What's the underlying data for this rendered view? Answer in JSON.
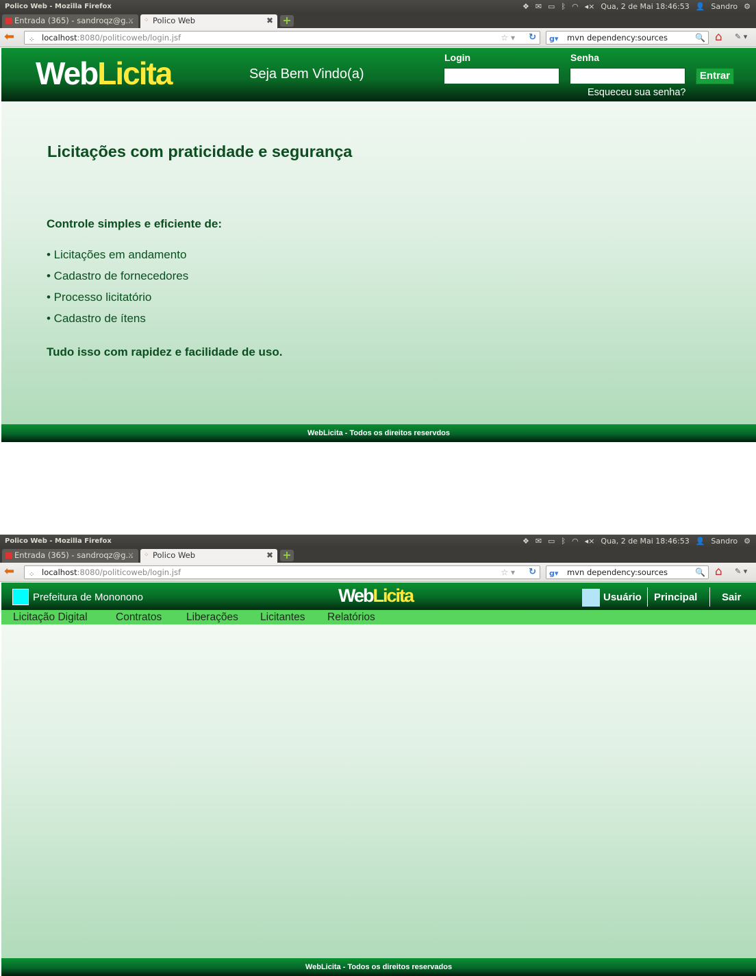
{
  "screenshots": [
    {
      "window_title": "Polico Web - Mozilla Firefox",
      "tray": {
        "date_time": "Qua, 2 de Mai 18:46:53",
        "user": "Sandro"
      },
      "tabs": [
        {
          "label": "Entrada (365) - sandroqz@g..."
        },
        {
          "label": "Polico Web"
        }
      ],
      "url": {
        "host": "localhost",
        "rest": ":8080/politicoweb/login.jsf"
      },
      "search": {
        "value": "mvn dependency:sources"
      },
      "header": {
        "logo_web": "Web",
        "logo_licita": "Licita",
        "welcome": "Seja Bem Vindo(a)",
        "login_label": "Login",
        "senha_label": "Senha",
        "entrar": "Entrar",
        "forgot": "Esqueceu sua senha?"
      },
      "content": {
        "headline": "Licitações com praticidade e segurança",
        "subtitle": "Controle simples e eficiente de:",
        "features": [
          "• Licitações em andamento",
          "• Cadastro de fornecedores",
          "• Processo licitatório",
          "• Cadastro de ítens"
        ],
        "tagline": "Tudo isso com rapidez e facilidade de uso."
      },
      "footer": "WebLicita - Todos os direitos reservdos"
    },
    {
      "window_title": "Polico Web - Mozilla Firefox",
      "tray": {
        "date_time": "Qua, 2 de Mai 18:46:53",
        "user": "Sandro"
      },
      "tabs": [
        {
          "label": "Entrada (365) - sandroqz@g..."
        },
        {
          "label": "Polico Web"
        }
      ],
      "url": {
        "host": "localhost",
        "rest": ":8080/politicoweb/login.jsf"
      },
      "search": {
        "value": "mvn dependency:sources"
      },
      "header": {
        "org": "Prefeitura de Mononono",
        "logo_web": "Web",
        "logo_licita": "Licita",
        "usuario": "Usuário",
        "principal": "Principal",
        "sair": "Sair"
      },
      "menu": [
        "Licitação Digital",
        "Contratos",
        "Liberações",
        "Licitantes",
        "Relatórios"
      ],
      "footer": "WebLicita - Todos os direitos reservados"
    }
  ],
  "colors": {
    "brand_green": "#0b9132",
    "logo_yellow": "#ffe93a",
    "menu_green": "#57d55c",
    "text_dark_green": "#0b4e1f"
  },
  "icons": [
    "dropbox-icon",
    "mail-icon",
    "battery-icon",
    "bluetooth-icon",
    "wifi-icon",
    "volume-icon",
    "user-icon",
    "power-icon",
    "back-arrow-icon",
    "bookmark-star-icon",
    "reload-icon",
    "google-icon",
    "search-icon",
    "home-icon",
    "addon-icon"
  ]
}
